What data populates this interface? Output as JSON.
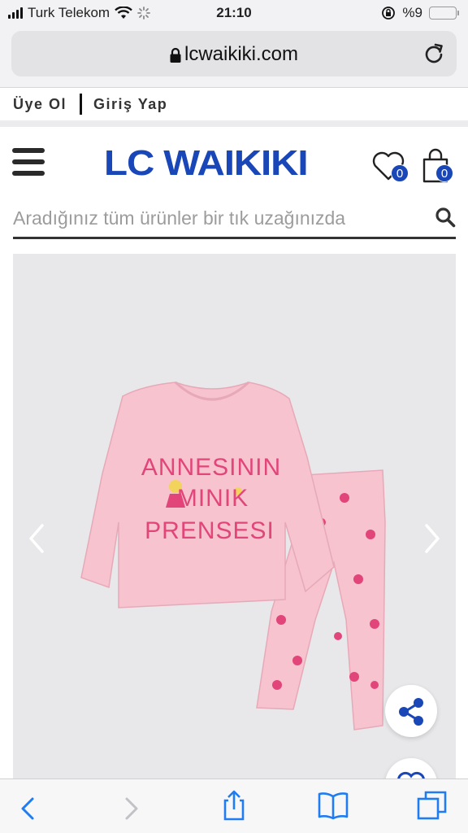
{
  "status_bar": {
    "carrier": "Turk Telekom",
    "time": "21:10",
    "battery_text": "%9",
    "battery_level": 0.09,
    "battery_color": "#f5c400"
  },
  "browser": {
    "url": "lcwaikiki.com",
    "lock_icon": "lock-icon",
    "reload_icon": "reload-icon"
  },
  "account": {
    "register_label": "Üye Ol",
    "login_label": "Giriş Yap"
  },
  "header": {
    "logo_text": "LC WAIKIKI",
    "brand_color": "#1a47b8",
    "favorites_count": "0",
    "cart_count": "0"
  },
  "search": {
    "placeholder": "Aradığınız tüm ürünler bir tık uzağınızda"
  },
  "product": {
    "print_lines": [
      "ANNESININ",
      "MINIK",
      "PRENSESI"
    ],
    "print_color": "#e2457a",
    "garment_color": "#f6c3cf"
  },
  "toolbar": {
    "icons": [
      "back-icon",
      "forward-icon",
      "share-icon",
      "bookmarks-icon",
      "tabs-icon"
    ]
  }
}
